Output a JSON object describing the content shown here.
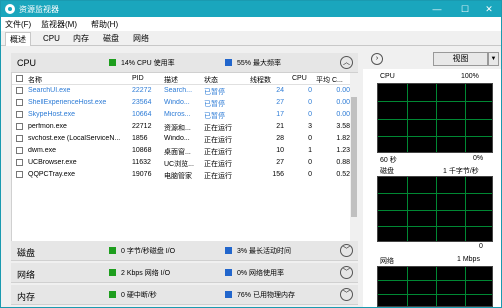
{
  "window": {
    "title": "资源监视器",
    "controls": [
      "—",
      "☐",
      "✕"
    ]
  },
  "menu": [
    {
      "label": "文件(F)"
    },
    {
      "label": "监视器(M)"
    },
    {
      "label": "帮助(H)"
    }
  ],
  "tabs": [
    {
      "label": "概述",
      "active": true
    },
    {
      "label": "CPU",
      "active": false
    },
    {
      "label": "内存",
      "active": false
    },
    {
      "label": "磁盘",
      "active": false
    },
    {
      "label": "网络",
      "active": false
    }
  ],
  "cpu_section": {
    "title": "CPU",
    "stat1": "14% CPU 使用率",
    "stat2": "55% 最大频率",
    "chevron": "︿"
  },
  "process_table": {
    "headers": [
      "名称",
      "PID",
      "描述",
      "状态",
      "线程数",
      "CPU",
      "平均 C..."
    ],
    "rows": [
      {
        "name": "SearchUI.exe",
        "pid": "22272",
        "desc": "Search...",
        "status": "已暂停",
        "threads": "24",
        "cpu": "0",
        "avg": "0.00",
        "suspended": true
      },
      {
        "name": "ShellExperienceHost.exe",
        "pid": "23564",
        "desc": "Windo...",
        "status": "已暂停",
        "threads": "27",
        "cpu": "0",
        "avg": "0.00",
        "suspended": true
      },
      {
        "name": "SkypeHost.exe",
        "pid": "10664",
        "desc": "Micros...",
        "status": "已暂停",
        "threads": "17",
        "cpu": "0",
        "avg": "0.00",
        "suspended": true
      },
      {
        "name": "perfmon.exe",
        "pid": "22712",
        "desc": "资源和...",
        "status": "正在运行",
        "threads": "21",
        "cpu": "3",
        "avg": "3.58",
        "suspended": false
      },
      {
        "name": "svchost.exe (LocalServiceN...",
        "pid": "1856",
        "desc": "Windo...",
        "status": "正在运行",
        "threads": "28",
        "cpu": "0",
        "avg": "1.82",
        "suspended": false
      },
      {
        "name": "dwm.exe",
        "pid": "10868",
        "desc": "桌面窗...",
        "status": "正在运行",
        "threads": "10",
        "cpu": "1",
        "avg": "1.23",
        "suspended": false
      },
      {
        "name": "UCBrowser.exe",
        "pid": "11632",
        "desc": "UC浏览...",
        "status": "正在运行",
        "threads": "27",
        "cpu": "0",
        "avg": "0.88",
        "suspended": false
      },
      {
        "name": "QQPCTray.exe",
        "pid": "19076",
        "desc": "电脑管家",
        "status": "正在运行",
        "threads": "156",
        "cpu": "0",
        "avg": "0.52",
        "suspended": false
      }
    ]
  },
  "disk_section": {
    "title": "磁盘",
    "stat1": "0 字节/秒磁盘 I/O",
    "stat2": "3% 最长活动时间",
    "chevron": "﹀"
  },
  "network_section": {
    "title": "网络",
    "stat1": "2 Kbps 网络 I/O",
    "stat2": "0% 网络使用率",
    "chevron": "﹀"
  },
  "memory_section": {
    "title": "内存",
    "stat1": "0 硬中断/秒",
    "stat2": "76% 已用物理内存",
    "chevron": "﹀"
  },
  "right_panel": {
    "expand_icon": "›",
    "view_label": "视图",
    "view_dropdown": "▼",
    "cpu_graph": {
      "label": "CPU",
      "max": "100%",
      "time": "60 秒",
      "min": "0%"
    },
    "disk_graph": {
      "label": "磁盘",
      "max": "1 千字节/秒",
      "min": "0"
    },
    "network_graph": {
      "label": "网络",
      "max": "1 Mbps"
    }
  },
  "colors": {
    "accent": "#1aa6bd",
    "green": "#1e9e1e",
    "blue": "#2266cc",
    "suspended_text": "#2c7bd6"
  }
}
